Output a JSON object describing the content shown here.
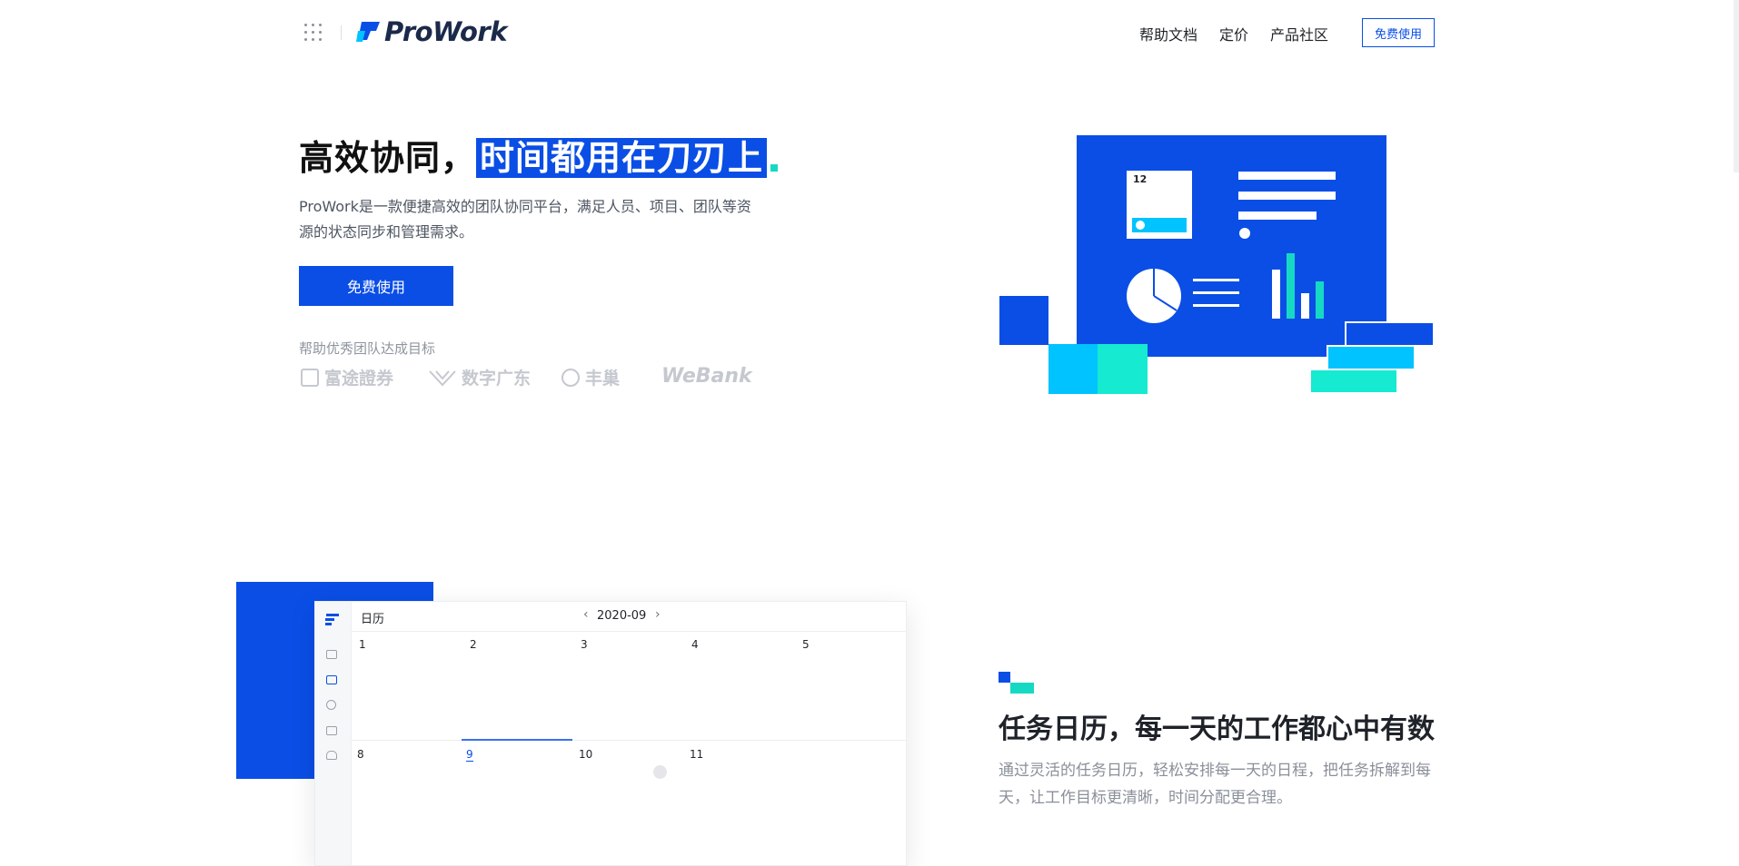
{
  "header": {
    "brand": "ProWork",
    "nav": [
      "帮助文档",
      "定价",
      "产品社区"
    ],
    "cta": "免费使用"
  },
  "hero": {
    "title_plain": "高效协同，",
    "title_highlight": "时间都用在刀刃上",
    "description": "ProWork是一款便捷高效的团队协同平台，满足人员、项目、团队等资源的状态同步和管理需求。",
    "button": "免费使用",
    "clients_label": "帮助优秀团队达成目标",
    "clients": [
      "富途證券",
      "数字广东",
      "丰巢",
      "WeBank"
    ]
  },
  "illustration": {
    "card_number": "12"
  },
  "calendar": {
    "title": "日历",
    "month": "2020-09",
    "week1": [
      "1",
      "2",
      "3",
      "4",
      "5"
    ],
    "week2": [
      "8",
      "9",
      "10",
      "11"
    ]
  },
  "feature": {
    "title": "任务日历，每一天的工作都心中有数",
    "description": "通过灵活的任务日历，轻松安排每一天的日程，把任务拆解到每天，让工作目标更清晰，时间分配更合理。"
  },
  "colors": {
    "brand_blue": "#0a4ee6",
    "accent_cyan": "#16d9c4",
    "accent_sky": "#00c3ff"
  }
}
